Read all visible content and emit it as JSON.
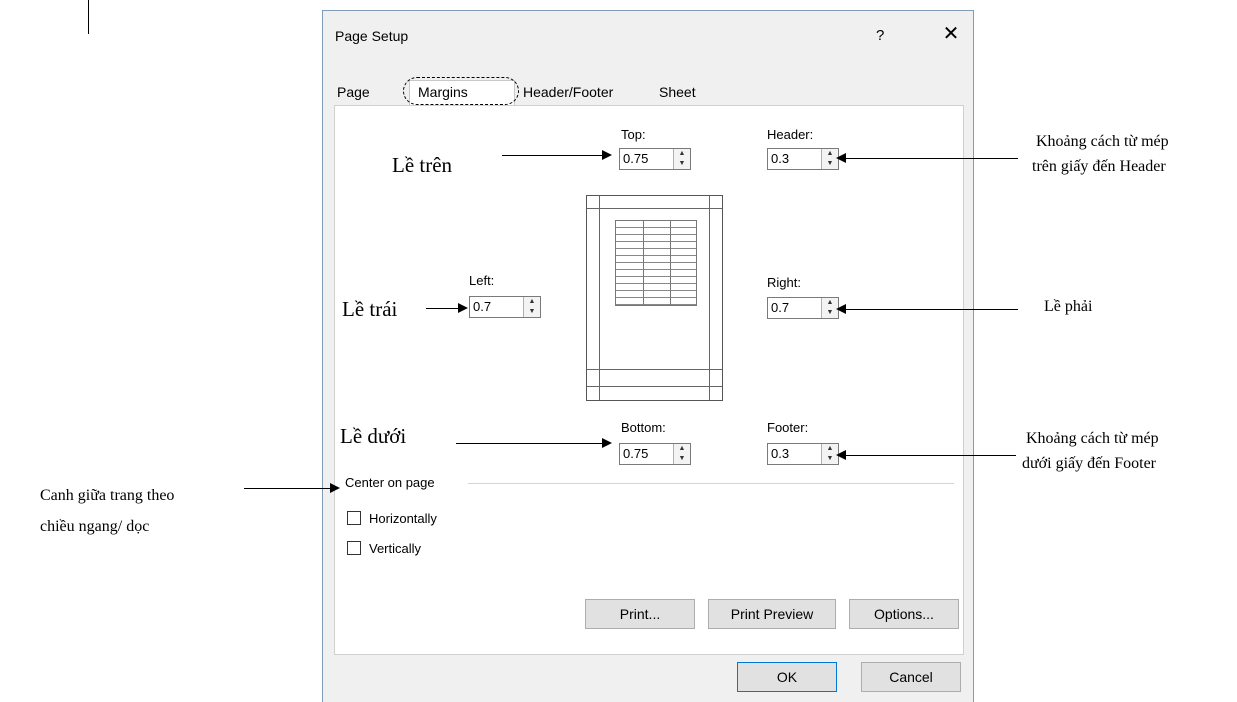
{
  "dialog": {
    "title": "Page Setup",
    "help": "?",
    "close": "✕"
  },
  "tabs": [
    {
      "label": "Page"
    },
    {
      "label": "Margins"
    },
    {
      "label": "Header/Footer"
    },
    {
      "label": "Sheet"
    }
  ],
  "fields": {
    "top": {
      "label": "Top:",
      "value": "0.75"
    },
    "header": {
      "label": "Header:",
      "value": "0.3"
    },
    "left": {
      "label": "Left:",
      "value": "0.7"
    },
    "right": {
      "label": "Right:",
      "value": "0.7"
    },
    "bottom": {
      "label": "Bottom:",
      "value": "0.75"
    },
    "footer": {
      "label": "Footer:",
      "value": "0.3"
    }
  },
  "center": {
    "title": "Center on page",
    "horizontally": "Horizontally",
    "vertically": "Vertically"
  },
  "buttons": {
    "print": "Print...",
    "print_preview": "Print Preview",
    "options": "Options...",
    "ok": "OK",
    "cancel": "Cancel"
  },
  "annotations": {
    "le_tren": "Lề trên",
    "le_trai": "Lề trái",
    "le_duoi": "Lề dưới",
    "le_phai": "Lề phải",
    "header_line1": "Khoảng cách từ mép",
    "header_line2": "trên giấy đến Header",
    "footer_line1": "Khoảng cách từ mép",
    "footer_line2": "dưới  giấy  đến Footer",
    "center_line1": "Canh giữa trang theo",
    "center_line2": "chiều ngang/ dọc"
  }
}
